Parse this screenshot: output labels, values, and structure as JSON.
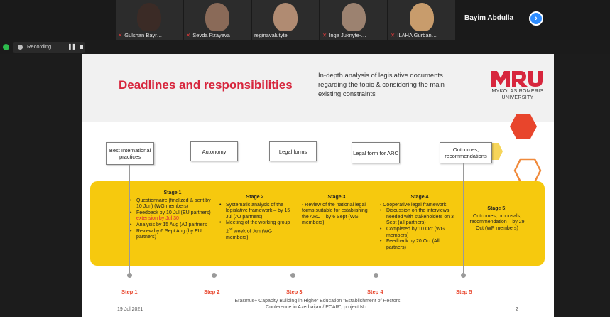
{
  "participants": [
    {
      "name": "Gulshan Bayr…",
      "face": "#3b2b26"
    },
    {
      "name": "Sevda Rzayeva",
      "face": "#8a6a58"
    },
    {
      "name": "reginavalutyte",
      "face": "#b08b72"
    },
    {
      "name": "Inga Juknyte-…",
      "face": "#9c8270"
    },
    {
      "name": "ILAHA Gurban…",
      "face": "#c89c6c"
    }
  ],
  "active_speaker": "Bayim Abdulla",
  "recording": {
    "label": "Recording..."
  },
  "slide": {
    "title": "Deadlines and responsibilities",
    "subtitle": "In-depth analysis of legislative documents regarding the topic & considering the main existing constraints",
    "logo_name_line1": "MYKOLAS ROMERIS",
    "logo_name_line2": "UNIVERSITY",
    "stage_boxes": [
      "Best International practices",
      "Autonomy",
      "Legal forms",
      "Legal form for ARC",
      "Outcomes, recommendations"
    ],
    "stages": [
      {
        "heading": "Stage 1",
        "items": [
          "Questionnaire (finalized & sent by 10 Jun) (WG members)",
          "Analysis by 15 Aug (AJ partners",
          "Review by 6 Sept Aug (by EU partners)"
        ],
        "feedback_prefix": "Feedback by 10 Jul (EU partners) – ",
        "feedback_ext": "extension by Jul 30"
      },
      {
        "heading": "Stage 2",
        "items": [
          "Systematic analysis of the legislative framework – by 15 Jul (AJ partners)"
        ],
        "meeting_a": "Meeting of the working group 2",
        "meeting_sup": "nd",
        "meeting_b": " week of Jun (WG members)"
      },
      {
        "heading": "Stage 3",
        "text": "- Review of the national legal forms suitable for establishing the ARC – by 6 Sept (WG members)"
      },
      {
        "heading": "Stage 4",
        "intro": "- Cooperative legal framework:",
        "items": [
          "Discussion on the interviews needed with stakeholders on 3 Sept (all partners)",
          "Completed by 10 Oct (WG members)",
          "Feedback by 20 Oct (All partners)"
        ]
      },
      {
        "heading": "Stage 5:",
        "text": "Outcomes, proposals, recommendation – by 29 Oct (WP members)"
      }
    ],
    "steps": [
      "Step 1",
      "Step 2",
      "Step 3",
      "Step 4",
      "Step 5"
    ],
    "footer_date": "19 Jul 2021",
    "footer_text": "Erasmus+ Capacity Building in Higher Education \"Establishment of Rectors Conference in Azerbaijan / ECAR\", project No.:",
    "page_number": "2"
  },
  "colors": {
    "accent_red": "#d7263d",
    "band_yellow": "#f6c90e",
    "hex_red": "#e8452c",
    "hex_orange": "#f08a3c",
    "hex_yellow": "#f6d55a",
    "zoom_blue": "#2d8cff"
  }
}
